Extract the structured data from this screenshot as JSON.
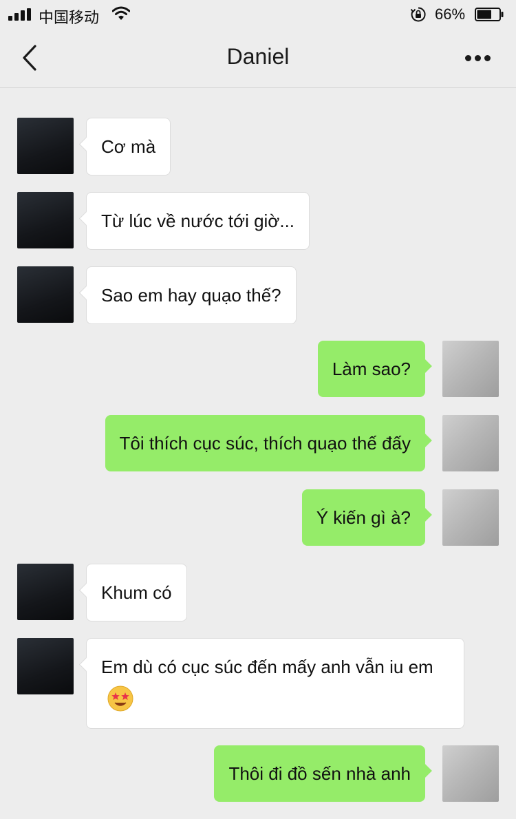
{
  "status_bar": {
    "carrier": "中国移动",
    "battery_percent": "66%",
    "battery_level": 0.66,
    "signal_icon": "signal-bars-icon",
    "wifi_icon": "wifi-icon",
    "orientation_lock_icon": "orientation-lock-icon",
    "battery_icon": "battery-icon"
  },
  "nav": {
    "title": "Daniel",
    "back_icon": "chevron-left-icon",
    "more_icon": "more-dots-icon"
  },
  "colors": {
    "background": "#ededed",
    "outgoing_bubble": "#95ec69",
    "incoming_bubble": "#ffffff"
  },
  "messages": [
    {
      "side": "left",
      "text": "Cơ mà"
    },
    {
      "side": "left",
      "text": "Từ lúc về nước tới giờ..."
    },
    {
      "side": "left",
      "text": "Sao em hay quạo thế?"
    },
    {
      "side": "right",
      "text": "Làm sao?"
    },
    {
      "side": "right",
      "text": "Tôi thích cục súc, thích quạo thế đấy"
    },
    {
      "side": "right",
      "text": "Ý kiến gì à?"
    },
    {
      "side": "left",
      "text": "Khum có"
    },
    {
      "side": "left",
      "text": "Em dù có cục súc đến mấy anh vẫn iu em",
      "emoji": "star-struck-emoji-icon"
    },
    {
      "side": "right",
      "text": "Thôi đi đồ sến nhà anh"
    }
  ]
}
